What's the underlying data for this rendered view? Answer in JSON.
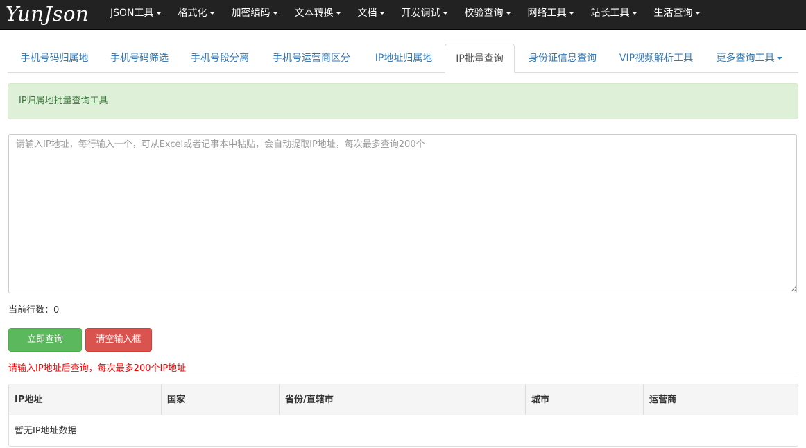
{
  "brand": "YunJson",
  "nav": [
    {
      "label": "JSON工具",
      "dropdown": true
    },
    {
      "label": "格式化",
      "dropdown": true
    },
    {
      "label": "加密编码",
      "dropdown": true
    },
    {
      "label": "文本转换",
      "dropdown": true
    },
    {
      "label": "文档",
      "dropdown": true
    },
    {
      "label": "开发调试",
      "dropdown": true
    },
    {
      "label": "校验查询",
      "dropdown": true
    },
    {
      "label": "网络工具",
      "dropdown": true
    },
    {
      "label": "站长工具",
      "dropdown": true
    },
    {
      "label": "生活查询",
      "dropdown": true
    }
  ],
  "tabs": [
    {
      "label": "手机号码归属地"
    },
    {
      "label": "手机号码筛选"
    },
    {
      "label": "手机号段分离"
    },
    {
      "label": "手机号运营商区分"
    },
    {
      "label": "IP地址归属地"
    },
    {
      "label": "IP批量查询",
      "active": true
    },
    {
      "label": "身份证信息查询"
    },
    {
      "label": "VIP视频解析工具"
    },
    {
      "label": "更多查询工具",
      "dropdown": true
    }
  ],
  "alert": {
    "text": "IP归属地批量查询工具"
  },
  "input": {
    "value": "",
    "placeholder": "请输入IP地址，每行输入一个，可从Excel或者记事本中粘贴，会自动提取IP地址，每次最多查询200个"
  },
  "line_count": {
    "label": "当前行数：",
    "value": "0"
  },
  "buttons": {
    "query": "立即查询",
    "clear": "清空输入框"
  },
  "hint": "请输入IP地址后查询，每次最多200个IP地址",
  "table": {
    "headers": [
      "IP地址",
      "国家",
      "省份/直辖市",
      "城市",
      "运营商"
    ],
    "empty_text": "暂无IP地址数据"
  },
  "colors": {
    "navbar": "#222222",
    "link": "#337ab7",
    "success": "#5cb85c",
    "danger": "#d9534f",
    "alert_bg": "#dff0d8",
    "hint": "#ff0000"
  }
}
